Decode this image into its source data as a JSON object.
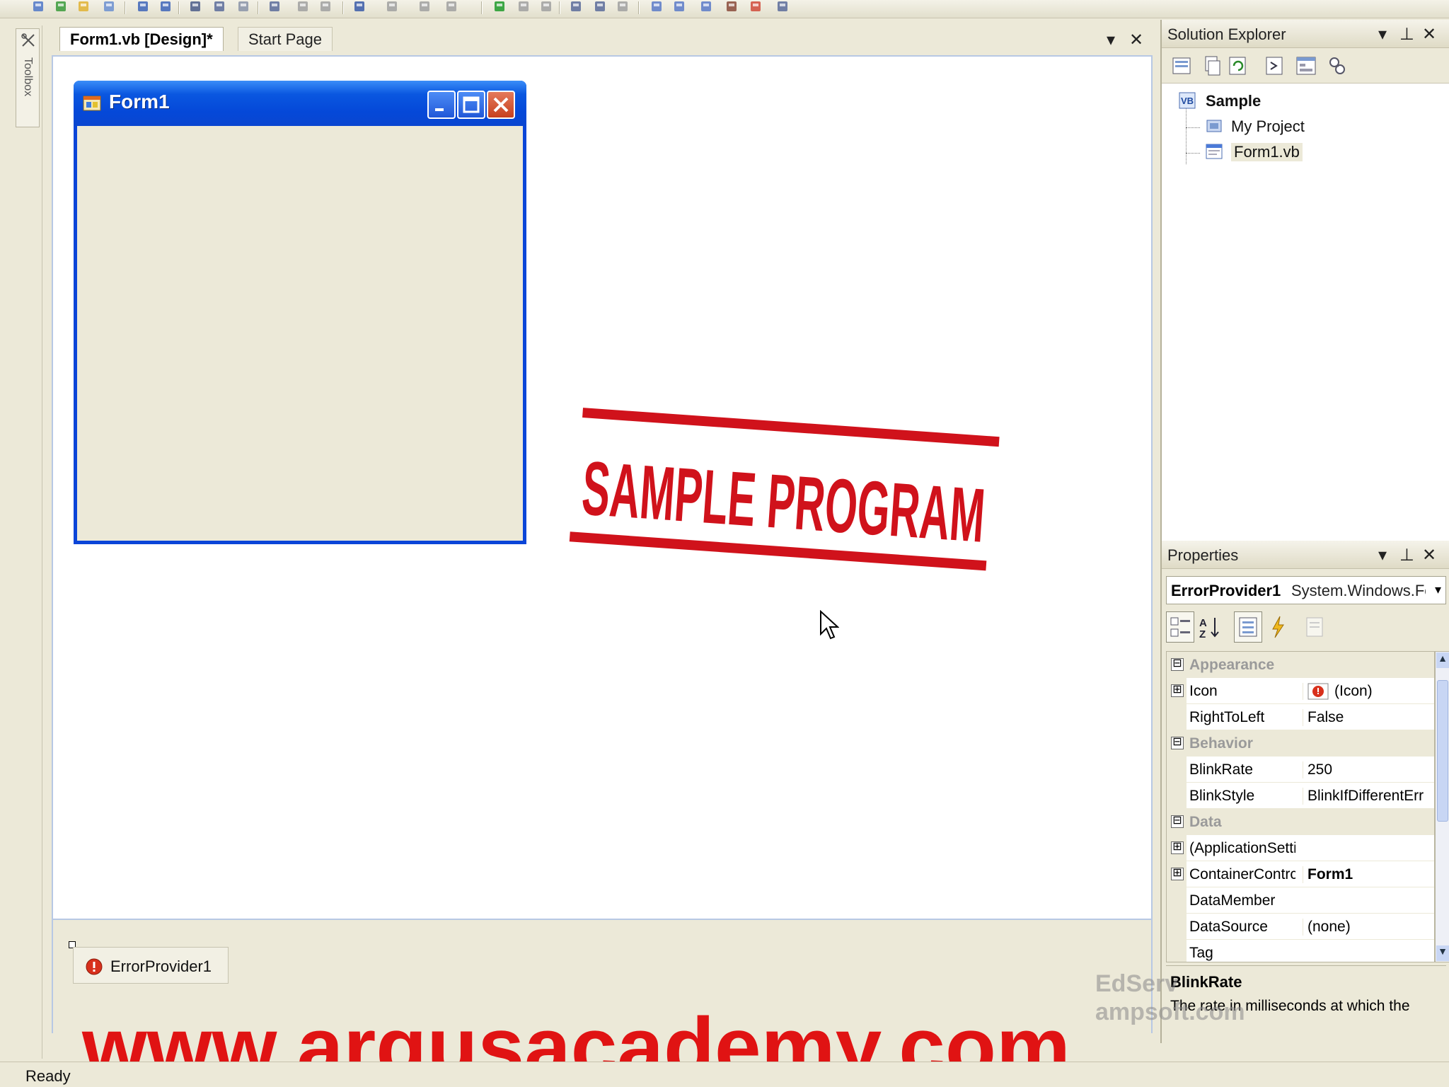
{
  "toolbar": {
    "icons": [
      "new-project-icon",
      "add-item-icon",
      "open-folder-icon",
      "add-new-item-icon",
      "save-icon",
      "save-all-icon",
      "cut-icon",
      "copy-icon",
      "paste-icon",
      "find-icon",
      "comment-icon",
      "uncomment-icon",
      "undo-icon",
      "redo-icon",
      "navigate-back-icon",
      "navigate-forward-icon",
      "start-debug-icon",
      "pause-icon",
      "stop-icon",
      "step-into-icon",
      "step-over-icon",
      "step-out-icon",
      "solution-explorer-icon",
      "properties-icon",
      "object-browser-icon",
      "toolbox-icon",
      "error-list-icon",
      "more-icon"
    ]
  },
  "toolbox": {
    "label": "Toolbox"
  },
  "documents": {
    "tabs": [
      {
        "label": "Form1.vb [Design]*",
        "active": true
      },
      {
        "label": "Start Page",
        "active": false
      }
    ],
    "dropdown_glyph": "▾",
    "close_glyph": "✕"
  },
  "form1": {
    "title": "Form1"
  },
  "stamp": {
    "text": "SAMPLE PROGRAM",
    "color": "#d0121b"
  },
  "component_tray": {
    "items": [
      {
        "label": "ErrorProvider1"
      }
    ]
  },
  "solution_explorer": {
    "title": "Solution Explorer",
    "tree": [
      {
        "label": "Sample",
        "bold": true
      },
      {
        "label": "My Project",
        "bold": false
      },
      {
        "label": "Form1.vb",
        "bold": false
      }
    ]
  },
  "properties": {
    "title": "Properties",
    "object_name": "ErrorProvider1",
    "object_type": "System.Windows.Fc",
    "rows": [
      {
        "type": "category",
        "name": "Appearance",
        "expander": "⊟"
      },
      {
        "type": "prop",
        "name": "Icon",
        "value": "(Icon)",
        "expander": "⊞",
        "has_icon": true
      },
      {
        "type": "prop",
        "name": "RightToLeft",
        "value": "False"
      },
      {
        "type": "category",
        "name": "Behavior",
        "expander": "⊟"
      },
      {
        "type": "prop",
        "name": "BlinkRate",
        "value": "250"
      },
      {
        "type": "prop",
        "name": "BlinkStyle",
        "value": "BlinkIfDifferentErr"
      },
      {
        "type": "category",
        "name": "Data",
        "expander": "⊟"
      },
      {
        "type": "prop",
        "name": "(ApplicationSetti",
        "value": "",
        "expander": "⊞"
      },
      {
        "type": "prop",
        "name": "ContainerContrc",
        "value": "Form1",
        "expander": "⊞",
        "bold_value": true
      },
      {
        "type": "prop",
        "name": "DataMember",
        "value": ""
      },
      {
        "type": "prop",
        "name": "DataSource",
        "value": "(none)"
      },
      {
        "type": "prop",
        "name": "Tag",
        "value": ""
      }
    ],
    "description": {
      "title": "BlinkRate",
      "text": "The rate in milliseconds at which the"
    }
  },
  "watermark": {
    "line1": "EdServ",
    "line2": "ampsoft.com"
  },
  "banner": {
    "text": "www.argusacademy.com"
  },
  "status": {
    "text": "Ready"
  }
}
